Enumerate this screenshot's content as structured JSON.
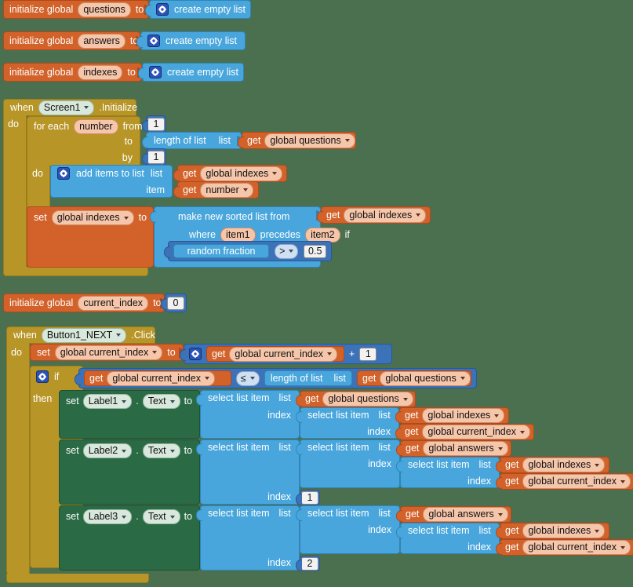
{
  "app": {
    "name": "MIT App Inventor Blocks Editor",
    "canvas_background": "#4a7050"
  },
  "colors": {
    "variable_orange": "#d2622a",
    "list_blue": "#49a6dc",
    "math_blue": "#3b72b8",
    "control_gold": "#b79527",
    "setter_green": "#2a6b45",
    "field_pill": "#f6c6ab"
  },
  "words": {
    "initialize_global": "initialize global",
    "to": "to",
    "get": "get",
    "set": "set",
    "when": "when",
    "do": "do",
    "then": "then",
    "if": "if",
    "for_each": "for each",
    "from": "from",
    "by": "by",
    "index": "index",
    "item": "item",
    "list": "list",
    "where": "where",
    "precedes": "precedes",
    "dot": ".",
    "plus": "+",
    "create_empty_list": "create empty list",
    "length_of_list": "length of list",
    "add_items_to_list": "add items to list",
    "make_new_sorted_list_from": "make new sorted list from",
    "random_fraction": "random fraction",
    "select_list_item": "select list item"
  },
  "blocks": {
    "init_questions": {
      "name": "questions",
      "value_label": "create empty list"
    },
    "init_answers": {
      "name": "answers",
      "value_label": "create empty list"
    },
    "init_indexes": {
      "name": "indexes",
      "value_label": "create empty list"
    },
    "screen_init": {
      "component": "Screen1",
      "event": ".Initialize",
      "loop": {
        "var": "number",
        "from": "1",
        "to_block": "length of list",
        "to_list_arg": "global questions",
        "by": "1"
      },
      "add_items": {
        "label": "add items to list",
        "list_arg": "global indexes",
        "item_arg": "number"
      },
      "set_indexes": {
        "target": "global indexes",
        "sort_label": "make new sorted list from",
        "sort_list_arg": "global indexes",
        "item1": "item1",
        "item2": "item2",
        "compare_left": "random fraction",
        "compare_op": ">",
        "compare_right": "0.5"
      }
    },
    "init_current_index": {
      "name": "current_index",
      "value": "0"
    },
    "button_click": {
      "component": "Button1_NEXT",
      "event": ".Click",
      "increment": {
        "target": "global current_index",
        "get_arg": "global current_index",
        "operator": "+",
        "addend": "1"
      },
      "condition": {
        "left_get": "global current_index",
        "operator": "≤",
        "right_block": "length of list",
        "right_list_arg": "global questions"
      },
      "setters": [
        {
          "component": "Label1",
          "property": "Text",
          "outer_list_arg": "global questions",
          "outer_is_block": false,
          "inner_list_arg": "global indexes",
          "inner_index_arg": "global current_index",
          "outer_index_literal": null
        },
        {
          "component": "Label2",
          "property": "Text",
          "outer_list_arg": "global answers",
          "outer_is_block": true,
          "inner_list_arg": "global indexes",
          "inner_index_arg": "global current_index",
          "outer_index_literal": "1"
        },
        {
          "component": "Label3",
          "property": "Text",
          "outer_list_arg": "global answers",
          "outer_is_block": true,
          "inner_list_arg": "global indexes",
          "inner_index_arg": "global current_index",
          "outer_index_literal": "2"
        }
      ]
    }
  }
}
